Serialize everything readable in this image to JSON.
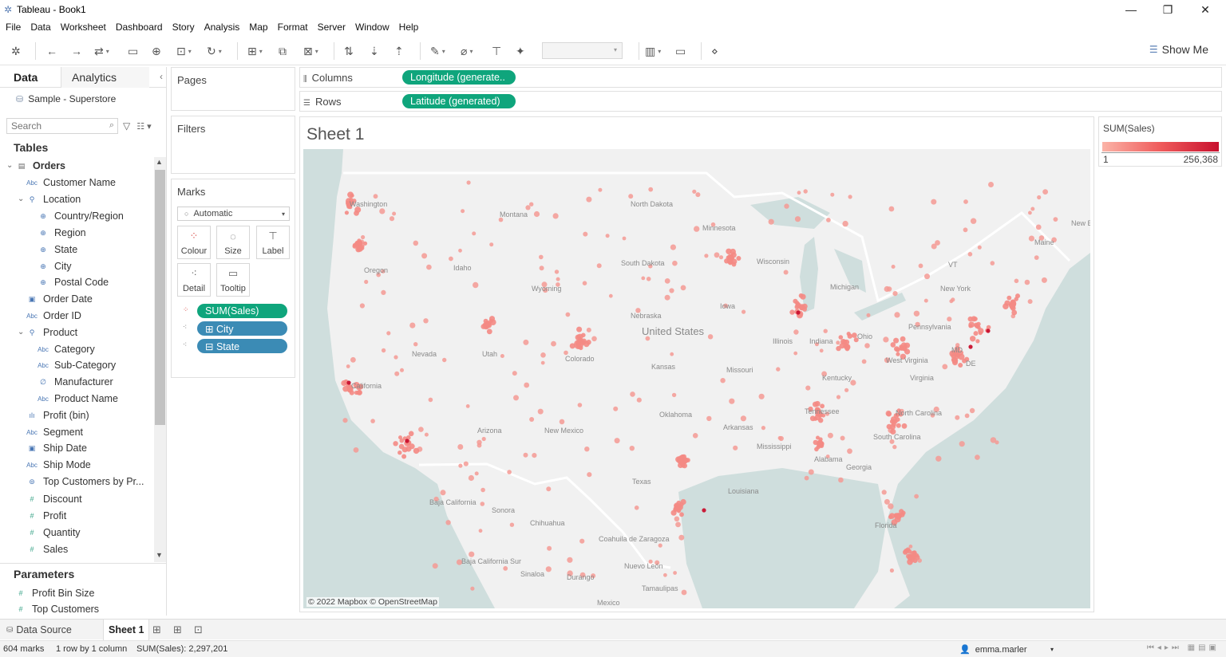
{
  "window": {
    "title": "Tableau - Book1",
    "minimize": "—",
    "maximize": "❐",
    "close": "✕"
  },
  "menu": [
    "File",
    "Data",
    "Worksheet",
    "Dashboard",
    "Story",
    "Analysis",
    "Map",
    "Format",
    "Server",
    "Window",
    "Help"
  ],
  "toolbar": {
    "show_me_label": "Show Me"
  },
  "data_pane": {
    "tab_data": "Data",
    "tab_analytics": "Analytics",
    "datasource": "Sample - Superstore",
    "search_placeholder": "Search",
    "tables_heading": "Tables",
    "fields": [
      {
        "label": "Orders",
        "type": "table",
        "level": 0,
        "bold": true
      },
      {
        "label": "Customer Name",
        "type": "abc",
        "level": 1
      },
      {
        "label": "Location",
        "type": "hierarchy",
        "level": 1
      },
      {
        "label": "Country/Region",
        "type": "geo",
        "level": 2
      },
      {
        "label": "Region",
        "type": "geo",
        "level": 2
      },
      {
        "label": "State",
        "type": "geo",
        "level": 2
      },
      {
        "label": "City",
        "type": "geo",
        "level": 2
      },
      {
        "label": "Postal Code",
        "type": "geo",
        "level": 2
      },
      {
        "label": "Order Date",
        "type": "date",
        "level": 1
      },
      {
        "label": "Order ID",
        "type": "abc",
        "level": 1
      },
      {
        "label": "Product",
        "type": "hierarchy",
        "level": 1
      },
      {
        "label": "Category",
        "type": "abc",
        "level": 2
      },
      {
        "label": "Sub-Category",
        "type": "abc",
        "level": 2
      },
      {
        "label": "Manufacturer",
        "type": "clip",
        "level": 2
      },
      {
        "label": "Product Name",
        "type": "abc",
        "level": 2
      },
      {
        "label": "Profit (bin)",
        "type": "bin",
        "level": 1
      },
      {
        "label": "Segment",
        "type": "abc",
        "level": 1
      },
      {
        "label": "Ship Date",
        "type": "date",
        "level": 1
      },
      {
        "label": "Ship Mode",
        "type": "abc",
        "level": 1
      },
      {
        "label": "Top Customers by Pr...",
        "type": "set",
        "level": 1
      },
      {
        "label": "Discount",
        "type": "num",
        "level": 1
      },
      {
        "label": "Profit",
        "type": "num",
        "level": 1
      },
      {
        "label": "Quantity",
        "type": "num",
        "level": 1
      },
      {
        "label": "Sales",
        "type": "num",
        "level": 1
      }
    ],
    "parameters_heading": "Parameters",
    "parameters": [
      "Profit Bin Size",
      "Top Customers"
    ]
  },
  "cards": {
    "pages_title": "Pages",
    "filters_title": "Filters",
    "marks_title": "Marks",
    "mark_type": "Automatic",
    "mark_buttons": [
      {
        "label": "Colour",
        "icon": "colour-icon"
      },
      {
        "label": "Size",
        "icon": "size-icon"
      },
      {
        "label": "Label",
        "icon": "label-icon"
      },
      {
        "label": "Detail",
        "icon": "detail-icon"
      },
      {
        "label": "Tooltip",
        "icon": "tooltip-icon"
      }
    ],
    "mark_pills": [
      {
        "label": "SUM(Sales)",
        "color": "#0fa57c"
      },
      {
        "label": "⊞ City",
        "color": "#3b8bb5"
      },
      {
        "label": "⊟ State",
        "color": "#3b8bb5"
      }
    ]
  },
  "shelves": {
    "columns_label": "Columns",
    "columns_pill": "Longitude (generate..",
    "rows_label": "Rows",
    "rows_pill": "Latitude (generated)"
  },
  "view": {
    "sheet_title": "Sheet 1",
    "map_attribution": "© 2022 Mapbox © OpenStreetMap",
    "map_labels": [
      "Washington",
      "Montana",
      "North Dakota",
      "Minnesota",
      "Oregon",
      "Idaho",
      "South Dakota",
      "Wisconsin",
      "Wyoming",
      "Michigan",
      "Nebraska",
      "Iowa",
      "United States",
      "Illinois",
      "Indiana",
      "Ohio",
      "Pennsylvania",
      "Nevada",
      "Utah",
      "Colorado",
      "Kansas",
      "Missouri",
      "West Virginia",
      "Virginia",
      "Kentucky",
      "California",
      "Oklahoma",
      "Tennessee",
      "North Carolina",
      "Arizona",
      "New Mexico",
      "Arkansas",
      "South Carolina",
      "Mississippi",
      "Alabama",
      "Georgia",
      "Texas",
      "Louisiana",
      "Baja California",
      "Sonora",
      "Chihuahua",
      "Coahuila de Zaragoza",
      "Baja California Sur",
      "Sinaloa",
      "Durango",
      "Nuevo León",
      "Tamaulipas",
      "Mexico",
      "Florida",
      "Maine",
      "New York",
      "VT",
      "MD",
      "DE",
      "New Brunswick"
    ]
  },
  "legend": {
    "title": "SUM(Sales)",
    "min": "1",
    "max": "256,368",
    "color_low": "#fbb3a7",
    "color_high": "#c8102e"
  },
  "bottom": {
    "data_source_tab": "Data Source",
    "sheet_tab": "Sheet 1",
    "status_marks": "604 marks",
    "status_rows": "1 row by 1 column",
    "status_sum": "SUM(Sales): 2,297,201",
    "user": "emma.marler"
  },
  "colors": {
    "accent_green": "#0fa57c",
    "accent_blue": "#3b8bb5",
    "mark_red": "#f08080"
  }
}
